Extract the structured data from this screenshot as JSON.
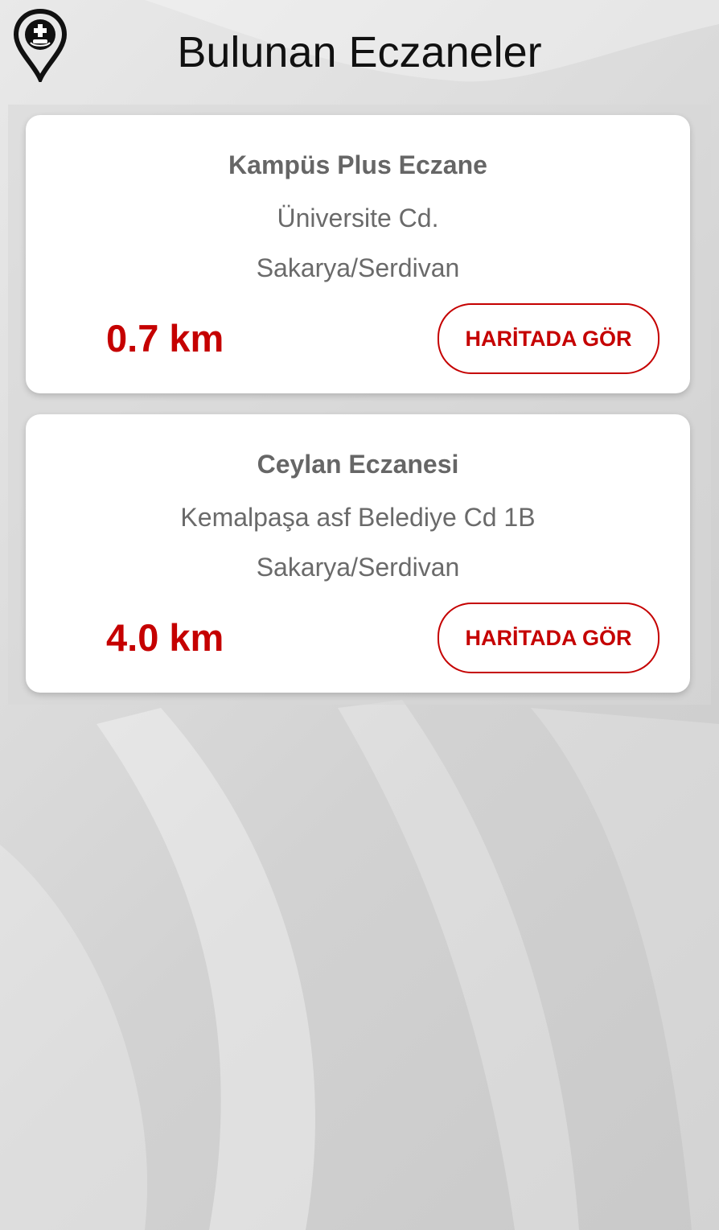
{
  "header": {
    "title": "Bulunan Eczaneler",
    "logo_icon": "pharmacy-location-pin-icon"
  },
  "colors": {
    "accent": "#c50000",
    "card_bg": "#ffffff",
    "text_muted": "#666666"
  },
  "pharmacies": [
    {
      "name": "Kampüs Plus Eczane",
      "street": "Üniversite Cd.",
      "city": "Sakarya/Serdivan",
      "distance": "0.7 km",
      "button_label": "HARİTADA GÖR"
    },
    {
      "name": "Ceylan Eczanesi",
      "street": "Kemalpaşa asf Belediye Cd 1B",
      "city": "Sakarya/Serdivan",
      "distance": "4.0 km",
      "button_label": "HARİTADA GÖR"
    }
  ]
}
